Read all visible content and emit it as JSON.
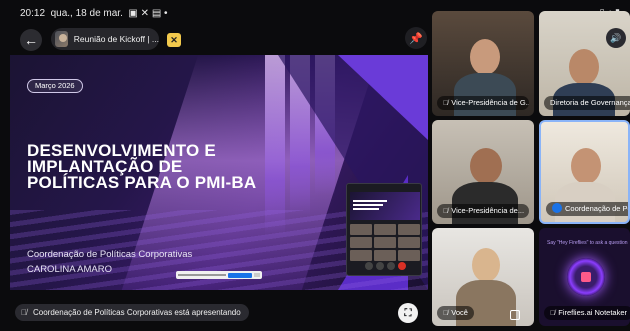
{
  "status_bar": {
    "time": "20:12",
    "date": "qua., 18 de mar."
  },
  "meeting": {
    "title": "Reunião de Kickoff | ..."
  },
  "slide": {
    "date_pill": "Março 2026",
    "title_lines": [
      "DESENVOLVIMENTO E",
      "IMPLANTAÇÃO DE",
      "POLÍTICAS PARA O PMI-BA"
    ],
    "subtitle": "Coordenação de Políticas Corporativas",
    "presenter_name": "CAROLINA AMARO"
  },
  "presenting_banner": "Coordenação de Políticas Corporativas está apresentando",
  "participants": [
    {
      "label": "Vice-Presidência de G...",
      "muted": true
    },
    {
      "label": "Diretoria de Governança",
      "muted": true
    },
    {
      "label": "Vice-Presidência de...",
      "muted": true
    },
    {
      "label": "Coordenação de Po...",
      "speaking": true
    },
    {
      "label": "Você",
      "muted": true
    },
    {
      "label": "Fireflies.ai Notetaker",
      "muted": true
    }
  ],
  "fireflies_tile_text": "Say \"Hey Fireflies\" to ask a question",
  "icons": {
    "back": "←",
    "pin": "pin-icon",
    "volume": "volume-icon",
    "fullscreen": "fullscreen-icon",
    "mic_off": "mic-off-icon"
  }
}
